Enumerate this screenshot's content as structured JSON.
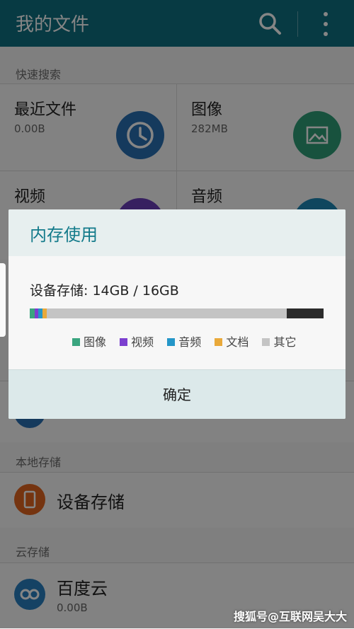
{
  "appbar": {
    "title": "我的文件",
    "search_icon": "search-icon",
    "more_icon": "more-vert-icon"
  },
  "quick_search": {
    "label": "快速搜索",
    "items": [
      {
        "title": "最近文件",
        "size": "0.00B",
        "icon": "clock-icon",
        "color": "#2a6fb3"
      },
      {
        "title": "图像",
        "size": "282MB",
        "icon": "image-icon",
        "color": "#2f9e78"
      },
      {
        "title": "视频",
        "size": "",
        "icon": "video-icon",
        "color": "#6a3fb8"
      },
      {
        "title": "音频",
        "size": "",
        "icon": "audio-icon",
        "color": "#1d86b5"
      }
    ]
  },
  "local_storage": {
    "label": "本地存储",
    "items": [
      {
        "title": "设备存储",
        "icon": "phone-icon",
        "color": "#e0641f"
      }
    ]
  },
  "cloud_storage": {
    "label": "云存储",
    "items": [
      {
        "title": "百度云",
        "size": "0.00B",
        "icon": "baidu-cloud-icon",
        "color": "#2a7fc0"
      }
    ]
  },
  "dialog": {
    "title": "内存使用",
    "storage_text": "设备存储: 14GB / 16GB",
    "usage": {
      "used_gb": 14,
      "total_gb": 16
    },
    "legend": [
      {
        "label": "图像",
        "color": "#3aa57f"
      },
      {
        "label": "视频",
        "color": "#7b3fcf"
      },
      {
        "label": "音频",
        "color": "#2496c8"
      },
      {
        "label": "文档",
        "color": "#e9a93a"
      },
      {
        "label": "其它",
        "color": "#c4c4c4"
      }
    ],
    "confirm_label": "确定"
  },
  "watermark": "搜狐号@互联网吴大大"
}
